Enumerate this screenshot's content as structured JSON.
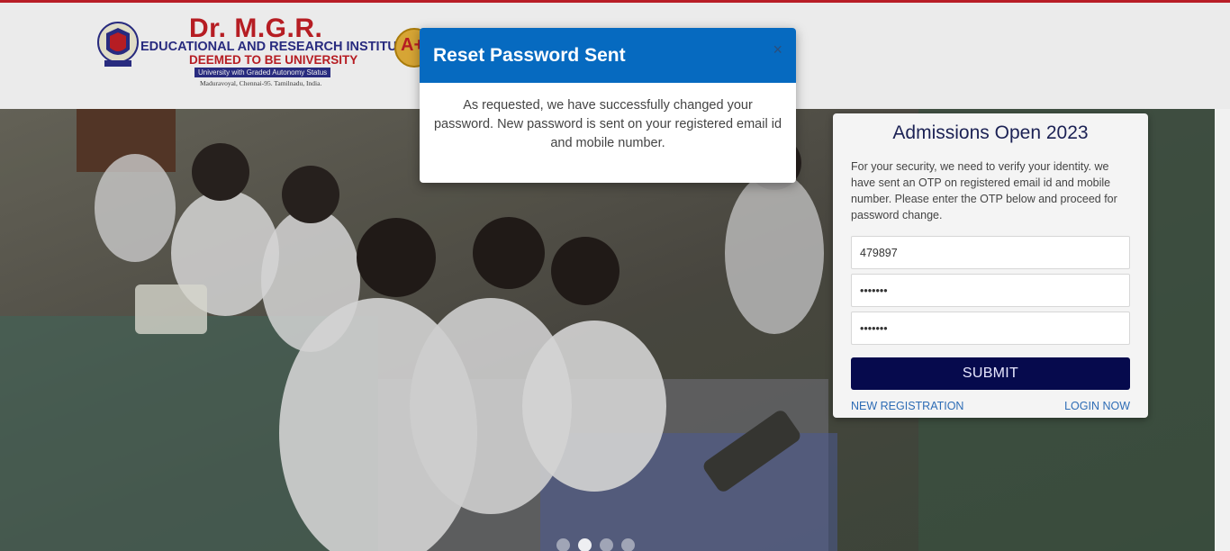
{
  "header": {
    "logo": {
      "name": "Dr. M.G.R.",
      "institute": "EDUCATIONAL AND RESEARCH INSTITUTE",
      "deemed": "DEEMED TO BE UNIVERSITY",
      "tagline": "University with Graded Autonomy Status",
      "address": "Maduravoyal, Chennai-95. Tamilnadu, India."
    },
    "accreditation_badge": "A+"
  },
  "modal": {
    "title": "Reset Password Sent",
    "close_icon": "×",
    "message": "As requested, we have successfully changed your password. New password is sent on your registered email id and mobile number."
  },
  "admissions": {
    "title": "Admissions Open 2023",
    "description": "For your security, we need to verify your identity. we have sent an OTP on registered email id and mobile number. Please enter the OTP below and proceed for password change.",
    "otp_value": "479897",
    "password_value": "•••••••",
    "confirm_password_value": "•••••••",
    "submit_label": "SUBMIT",
    "new_registration_label": "NEW REGISTRATION",
    "login_now_label": "LOGIN NOW"
  },
  "carousel": {
    "slide_count": 4,
    "active_index": 1
  },
  "colors": {
    "brand_red": "#c62026",
    "brand_navy": "#2c2f8a",
    "modal_header": "#066ac0",
    "submit_bg": "#060a4d",
    "link": "#2d6cb5"
  }
}
